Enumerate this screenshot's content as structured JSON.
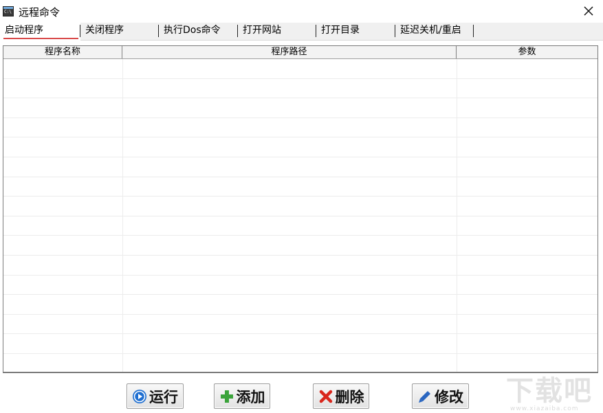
{
  "window": {
    "title": "远程命令",
    "close_label": "✕"
  },
  "tabs": [
    {
      "label": "启动程序",
      "active": true
    },
    {
      "label": "关闭程序",
      "active": false
    },
    {
      "label": "执行Dos命令",
      "active": false
    },
    {
      "label": "打开网站",
      "active": false
    },
    {
      "label": "打开目录",
      "active": false
    },
    {
      "label": "延迟关机/重启",
      "active": false
    }
  ],
  "table": {
    "columns": [
      "程序名称",
      "程序路径",
      "参数"
    ],
    "rows": []
  },
  "buttons": {
    "run": {
      "label": "运行",
      "icon": "play-circle-icon",
      "color": "#1f6fd1"
    },
    "add": {
      "label": "添加",
      "icon": "plus-icon",
      "color": "#3aa33a"
    },
    "delete": {
      "label": "删除",
      "icon": "x-icon",
      "color": "#d9261c"
    },
    "edit": {
      "label": "修改",
      "icon": "pencil-icon",
      "color": "#2a66c0"
    }
  },
  "watermark": {
    "text": "下载吧",
    "subtext": "www.xiazaiba.com"
  },
  "colors": {
    "tab_active_underline": "#d94a4a",
    "tab_bar": "#f0f0f0"
  }
}
